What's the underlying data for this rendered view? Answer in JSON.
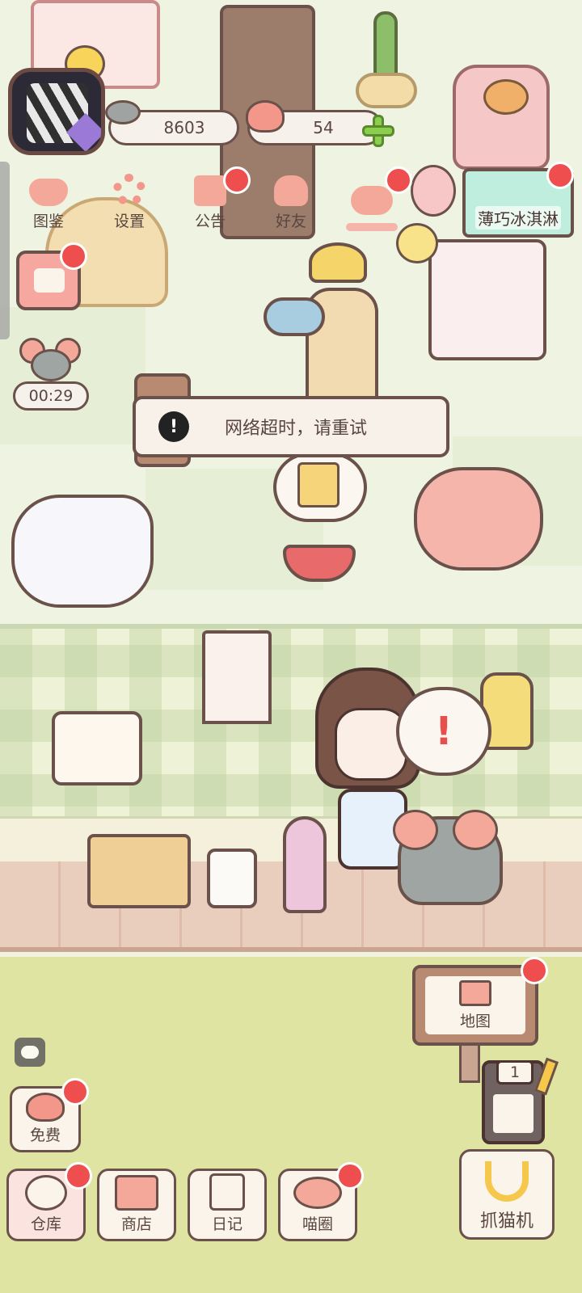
{
  "currency": {
    "fish_count": "8603",
    "hearts_count": "54"
  },
  "top_menu": [
    {
      "label": "图鉴"
    },
    {
      "label": "设置"
    },
    {
      "label": "公告"
    },
    {
      "label": "好友"
    },
    {
      "label": ""
    }
  ],
  "event_banner": {
    "label": "薄巧冰淇淋"
  },
  "timer": {
    "value": "00:29"
  },
  "toast": {
    "message": "网络超时，请重试",
    "icon": "exclamation-icon"
  },
  "map_button": {
    "label": "地图"
  },
  "free_button": {
    "label": "免费"
  },
  "claw_machine": {
    "label": "抓猫机",
    "count": "1"
  },
  "bottom_nav": [
    {
      "label": "仓库"
    },
    {
      "label": "商店"
    },
    {
      "label": "日记"
    },
    {
      "label": "喵圈"
    }
  ],
  "colors": {
    "outline": "#6a514a",
    "notification": "#ef4e4e",
    "accent_pink": "#f3a89a",
    "background": "#eff3e1"
  }
}
